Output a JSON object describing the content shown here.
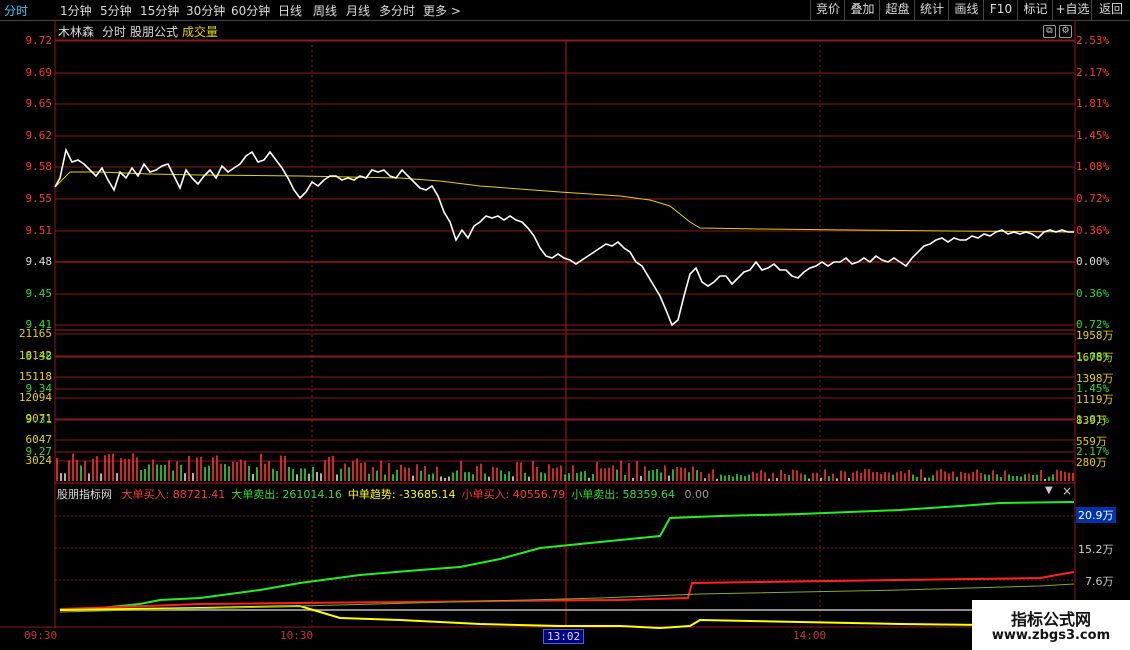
{
  "toolbar": {
    "left_items": [
      "分时",
      "1分钟",
      "5分钟",
      "15分钟",
      "30分钟",
      "60分钟",
      "日线",
      "周线",
      "月线",
      "多分时",
      "更多 >"
    ],
    "right_items": [
      "竞价",
      "叠加",
      "超盘",
      "统计",
      "画线",
      "F10",
      "标记",
      "+自选",
      "返回"
    ]
  },
  "main": {
    "stock_name": "木林森",
    "chart_kind": "分时",
    "indicator1": "股朋公式",
    "indicator2": "成交量",
    "price_labels": [
      "9.72",
      "9.69",
      "9.65",
      "9.62",
      "9.58",
      "9.55",
      "9.51",
      "9.48",
      "9.45",
      "9.41",
      "9.38",
      "9.34",
      "9.31",
      "9.27"
    ],
    "pct_labels": [
      "2.53%",
      "2.17%",
      "1.81%",
      "1.45%",
      "1.08%",
      "0.72%",
      "0.36%",
      "0.00%",
      "0.36%",
      "0.72%",
      "1.08%",
      "1.45%",
      "1.81%",
      "2.17%"
    ],
    "volume_left": [
      "21165",
      "18142",
      "15118",
      "12094",
      "9071",
      "6047",
      "3024"
    ],
    "volume_right": [
      "1958万",
      "1678万",
      "1398万",
      "1119万",
      "839万",
      "559万",
      "280万"
    ]
  },
  "colors": {
    "up": "#ff3333",
    "down": "#33dd33",
    "price_line": "#ffffff",
    "avg_line": "#e8d200",
    "grid": "#8b1a1a",
    "crosshair": "#b01818"
  },
  "indicator_panel": {
    "title": "股朋指标网",
    "items": [
      {
        "label": "大单买入:",
        "value": "88721.41",
        "color": "#ff3333"
      },
      {
        "label": "大单卖出:",
        "value": "261014.16",
        "color": "#33dd33"
      },
      {
        "label": "中单趋势:",
        "value": "-33685.14",
        "color": "#ffff00"
      },
      {
        "label": "小单买入:",
        "value": "40556.79",
        "color": "#ff3333"
      },
      {
        "label": "小单卖出:",
        "value": "58359.64",
        "color": "#33dd33"
      },
      {
        "label": "",
        "value": "0.00",
        "color": "#999999"
      }
    ],
    "right_labels": [
      "20.9万",
      "15.2万",
      "7.6万"
    ]
  },
  "time_axis": {
    "labels": [
      "09:30",
      "10:30",
      "14:00"
    ],
    "cursor_time": "13:02"
  },
  "watermark": {
    "line1": "指标公式网",
    "line2": "www.zbgs3.com"
  }
}
